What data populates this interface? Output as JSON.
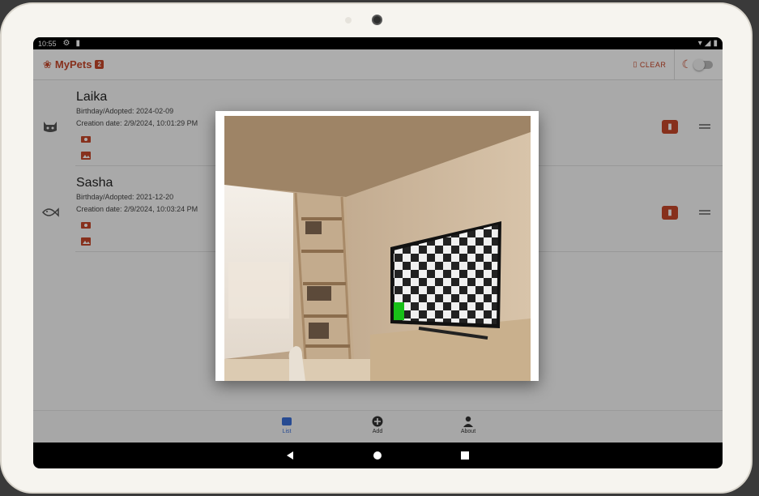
{
  "status_bar": {
    "time": "10:55",
    "icons": [
      "gear-icon",
      "sim-card-icon"
    ],
    "right_icons": [
      "wifi-icon",
      "signal-icon",
      "battery-icon"
    ]
  },
  "app_bar": {
    "title": "MyPets",
    "badge_count": "2",
    "clear_label": "CLEAR",
    "accent_color": "#c7472a",
    "dark_mode_on": false
  },
  "pets": [
    {
      "name": "Laika",
      "birthday": "Birthday/Adopted: 2024-02-09",
      "created": "Creation date: 2/9/2024, 10:01:29 PM",
      "type_icon": "cat-icon"
    },
    {
      "name": "Sasha",
      "birthday": "Birthday/Adopted: 2021-12-20",
      "created": "Creation date: 2/9/2024, 10:03:24 PM",
      "type_icon": "fish-icon"
    }
  ],
  "bottom_nav": {
    "list_label": "List",
    "add_label": "Add",
    "about_label": "About",
    "active": "List"
  },
  "dialog": {
    "image_icon": "room-with-tv-photo"
  }
}
